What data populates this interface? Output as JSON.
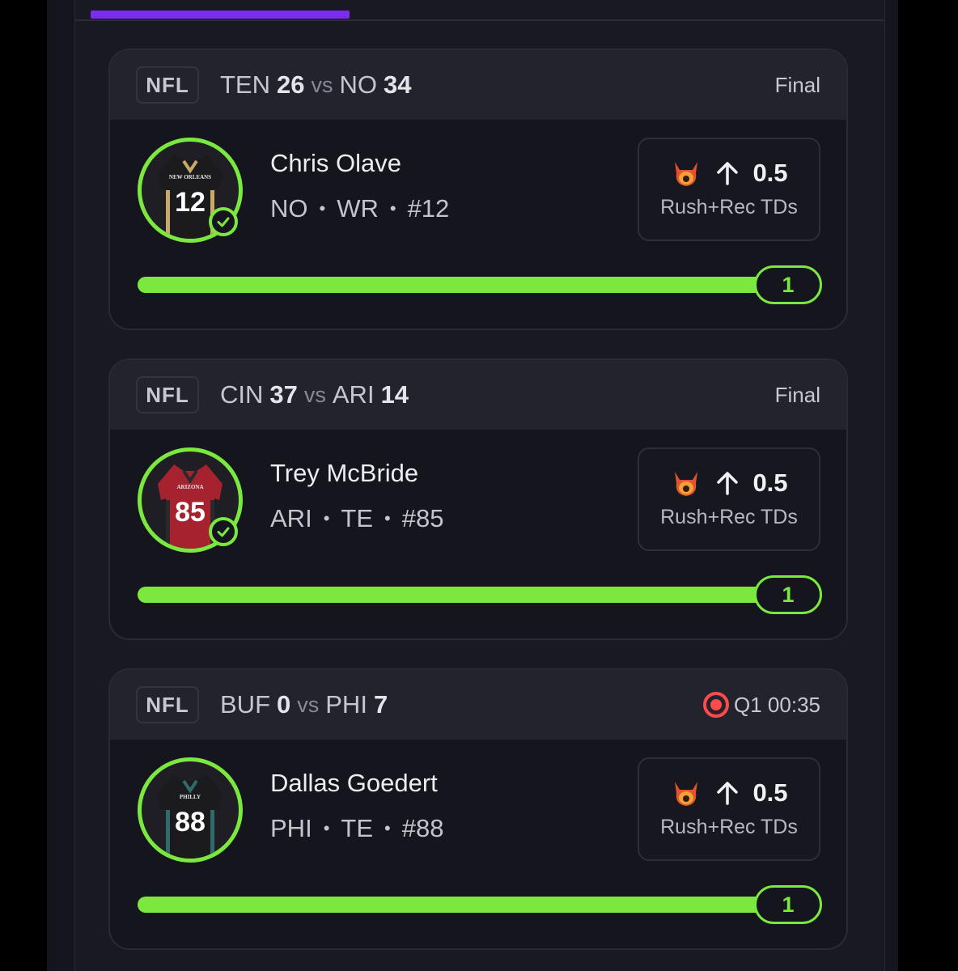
{
  "colors": {
    "accent_green": "#7ae83f",
    "tab_purple": "#7a2cf0",
    "live_red": "#ff4a4a",
    "background": "#15151d",
    "header_bg": "#23232d"
  },
  "cards": [
    {
      "league": "NFL",
      "home_team": "TEN",
      "home_score": "26",
      "vs": "vs",
      "away_team": "NO",
      "away_score": "34",
      "status": "Final",
      "is_live": false,
      "player": {
        "name": "Chris Olave",
        "team": "NO",
        "position": "WR",
        "number": "#12",
        "jersey_number": "12",
        "jersey_text": "NEW ORLEANS",
        "jersey_color": "#1b1b1e",
        "jersey_trim": "#c9a86a",
        "checked": true
      },
      "prop": {
        "icon": "demon-icon",
        "direction_icon": "arrow-up-icon",
        "line": "0.5",
        "stat": "Rush+Rec TDs"
      },
      "progress": {
        "value": "1",
        "fraction": 1.0
      },
      "separator": "•"
    },
    {
      "league": "NFL",
      "home_team": "CIN",
      "home_score": "37",
      "vs": "vs",
      "away_team": "ARI",
      "away_score": "14",
      "status": "Final",
      "is_live": false,
      "player": {
        "name": "Trey McBride",
        "team": "ARI",
        "position": "TE",
        "number": "#85",
        "jersey_number": "85",
        "jersey_text": "ARIZONA",
        "jersey_color": "#a5222e",
        "jersey_trim": "#2a2a2a",
        "checked": true
      },
      "prop": {
        "icon": "demon-icon",
        "direction_icon": "arrow-up-icon",
        "line": "0.5",
        "stat": "Rush+Rec TDs"
      },
      "progress": {
        "value": "1",
        "fraction": 1.0
      },
      "separator": "•"
    },
    {
      "league": "NFL",
      "home_team": "BUF",
      "home_score": "0",
      "vs": "vs",
      "away_team": "PHI",
      "away_score": "7",
      "status": "Q1 00:35",
      "is_live": true,
      "player": {
        "name": "Dallas Goedert",
        "team": "PHI",
        "position": "TE",
        "number": "#88",
        "jersey_number": "88",
        "jersey_text": "PHILLY",
        "jersey_color": "#1b1b1e",
        "jersey_trim": "#2f6b6b",
        "checked": false
      },
      "prop": {
        "icon": "demon-icon",
        "direction_icon": "arrow-up-icon",
        "line": "0.5",
        "stat": "Rush+Rec TDs"
      },
      "progress": {
        "value": "1",
        "fraction": 1.0
      },
      "separator": "•"
    }
  ]
}
